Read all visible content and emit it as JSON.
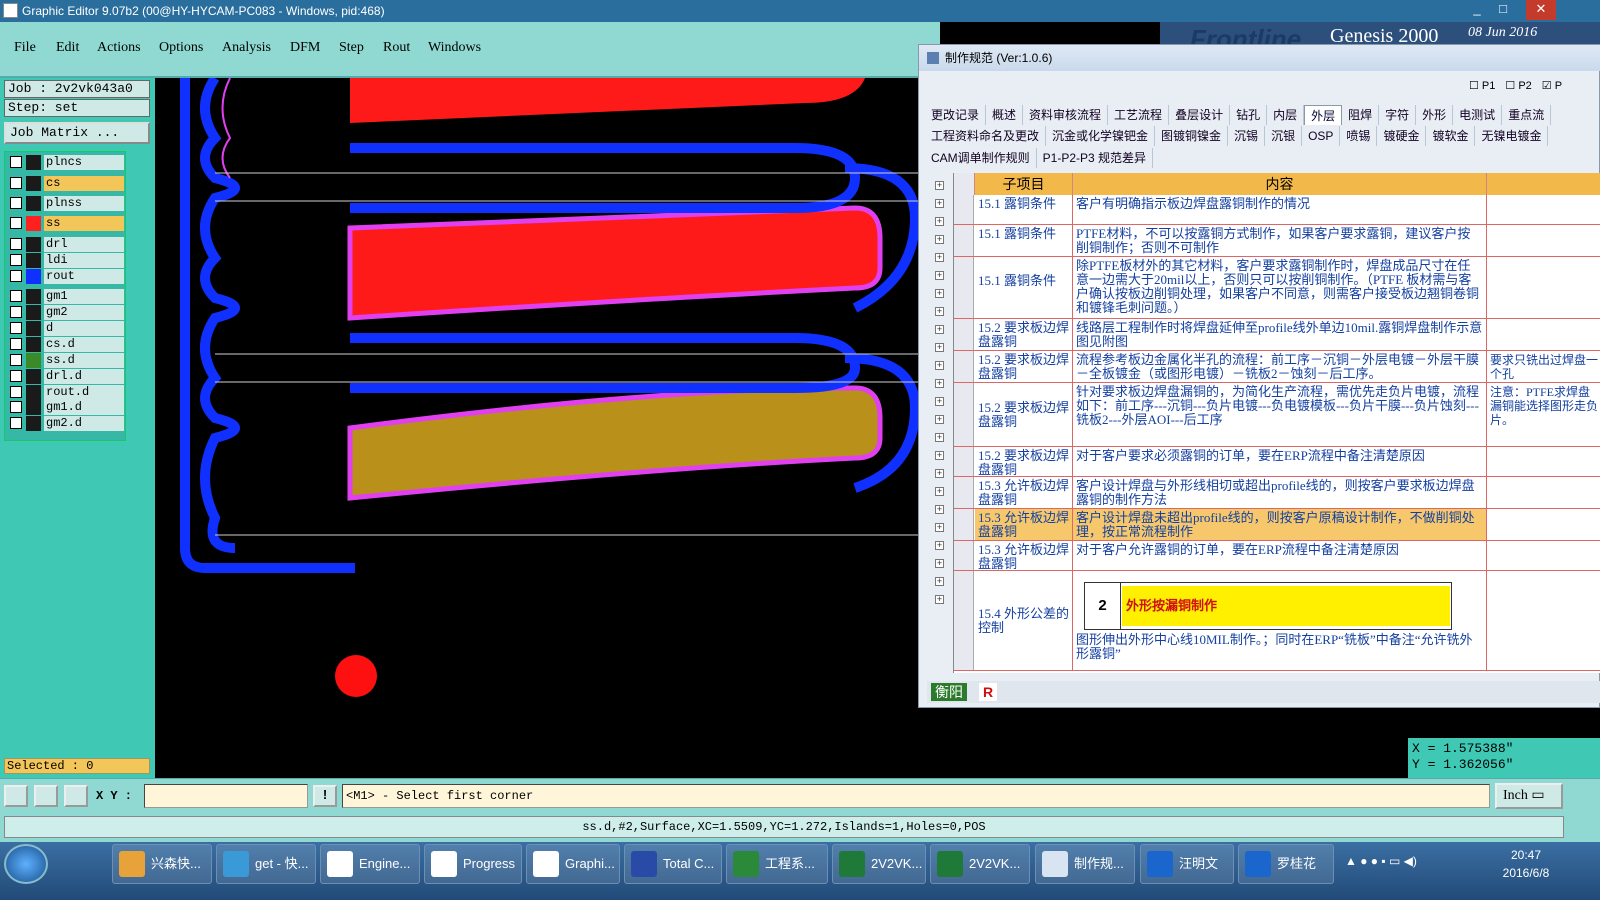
{
  "window": {
    "title": "Graphic Editor 9.07b2 (00@HY-HYCAM-PC083 - Windows, pid:468)",
    "controls": [
      "_",
      "□",
      "✕"
    ]
  },
  "menu": [
    "File",
    "Edit",
    "Actions",
    "Options",
    "Analysis",
    "DFM",
    "Step",
    "Rout",
    "Windows"
  ],
  "left": {
    "job": "Job : 2v2vk043a0",
    "step": "Step: set",
    "job_matrix": "Job Matrix ...",
    "layers": [
      {
        "name": "plncs",
        "color": "#1a1a1a",
        "bg": "#cfeae6"
      },
      {
        "name": "cs",
        "color": "#1a1a1a",
        "bg": "#f3c65a"
      },
      {
        "name": "plnss",
        "color": "#1a1a1a",
        "bg": "#cfeae6"
      },
      {
        "name": "ss",
        "color": "#ff2020",
        "bg": "#f3c65a"
      },
      {
        "name": "drl",
        "color": "#1a1a1a",
        "bg": "#cfeae6"
      },
      {
        "name": "ldi",
        "color": "#1a1a1a",
        "bg": "#cfeae6"
      },
      {
        "name": "rout",
        "color": "#1030ff",
        "bg": "#cfeae6"
      },
      {
        "name": "gm1",
        "color": "#1a1a1a",
        "bg": "#cfeae6"
      },
      {
        "name": "gm2",
        "color": "#1a1a1a",
        "bg": "#cfeae6"
      },
      {
        "name": "d",
        "color": "#1a1a1a",
        "bg": "#cfeae6"
      },
      {
        "name": "cs.d",
        "color": "#1a1a1a",
        "bg": "#cfeae6"
      },
      {
        "name": "ss.d",
        "color": "#3a8a2a",
        "bg": "#cfeae6"
      },
      {
        "name": "drl.d",
        "color": "#1a1a1a",
        "bg": "#cfeae6"
      },
      {
        "name": "rout.d",
        "color": "#1a1a1a",
        "bg": "#cfeae6"
      },
      {
        "name": "gm1.d",
        "color": "#1a1a1a",
        "bg": "#cfeae6"
      },
      {
        "name": "gm2.d",
        "color": "#1a1a1a",
        "bg": "#cfeae6"
      }
    ],
    "selected": "Selected : 0"
  },
  "banner": {
    "brand": "Frontline",
    "product": "Genesis 2000",
    "date": "08 Jun 2016"
  },
  "popup": {
    "title": "制作规范 (Ver:1.0.6)",
    "checks": [
      "P1",
      "P2",
      "P"
    ],
    "tabs_row1": [
      "更改记录",
      "概述",
      "资料审核流程",
      "工艺流程",
      "叠层设计",
      "钻孔",
      "内层",
      "外层",
      "阻焊",
      "字符",
      "外形",
      "电测试",
      "重点流"
    ],
    "active_tab": "外层",
    "tabs_row2": [
      "工程资料命名及更改",
      "沉金或化学镍钯金",
      "图镀铜镍金",
      "沉锡",
      "沉银",
      "OSP",
      "喷锡",
      "镀硬金",
      "镀软金",
      "无镍电镀金"
    ],
    "tabs_row3": [
      "CAM调单制作规则",
      "P1-P2-P3 规范差异"
    ],
    "header": [
      "子项目",
      "内容"
    ],
    "rows": [
      {
        "sub": "15.1 露铜条件",
        "content": "客户有明确指示板边焊盘露铜制作的情况",
        "note": ""
      },
      {
        "sub": "15.1 露铜条件",
        "content": "PTFE材料，不可以按露铜方式制作，如果客户要求露铜，建议客户按削铜制作；否则不可制作",
        "note": ""
      },
      {
        "sub": "15.1 露铜条件",
        "content": "除PTFE板材外的其它材料，客户要求露铜制作时，焊盘成品尺寸在任意一边需大于20mil以上，否则只可以按削铜制作。（PTFE 板材需与客户确认按板边削铜处理，如果客户不同意，则需客户接受板边翘铜卷铜和镀锋毛刺问题。）",
        "note": ""
      },
      {
        "sub": "15.2 要求板边焊盘露铜",
        "content": "线路层工程制作时将焊盘延伸至profile线外单边10mil.露铜焊盘制作示意图见附图",
        "note": ""
      },
      {
        "sub": "15.2 要求板边焊盘露铜",
        "content": "流程参考板边金属化半孔的流程：前工序－沉铜－外层电镀－外层干膜－全板镀金（或图形电镀）－铣板2－蚀刻－后工序。",
        "note": "要求只铣出过焊盘一个孔"
      },
      {
        "sub": "15.2 要求板边焊盘露铜",
        "content": "针对要求板边焊盘漏铜的，为简化生产流程，需优先走负片电镀，流程如下：前工序---沉铜---负片电镀---负电镀模板---负片干膜---负片蚀刻---铣板2---外层AOI---后工序",
        "note": "注意：PTFE求焊盘漏铜能选择图形走负片。"
      },
      {
        "sub": "15.2 要求板边焊盘露铜",
        "content": "对于客户要求必须露铜的订单，要在ERP流程中备注清楚原因",
        "note": ""
      },
      {
        "sub": "15.3 允许板边焊盘露铜",
        "content": "客户设计焊盘与外形线相切或超出profile线的，则按客户要求板边焊盘露铜的制作方法",
        "note": ""
      },
      {
        "sub": "15.3 允许板边焊盘露铜",
        "content": "客户设计焊盘未超出profile线的，则按客户原稿设计制作，不做削铜处理，按正常流程制作",
        "note": ""
      },
      {
        "sub": "15.3 允许板边焊盘露铜",
        "content": "对于客户允许露铜的订单，要在ERP流程中备注清楚原因",
        "note": ""
      },
      {
        "sub": "15.4 外形公差的控制",
        "content": "图形伸出外形中心线10MIL制作。；同时在ERP“铣板”中备注“允许铣外形露铜”",
        "note": ""
      }
    ],
    "embedded_num": "2",
    "embedded_text": "外形按漏铜制作",
    "status_left": "衡阳",
    "status_r": "R"
  },
  "coords": {
    "x": "X = 1.575388\"",
    "y": "Y = 1.362056\""
  },
  "cmd": {
    "xy_label": "X Y :",
    "xy_value": "",
    "prompt": "<M1> - Select first corner",
    "unit": "Inch"
  },
  "info": "ss.d,#2,Surface,XC=1.5509,YC=1.272,Islands=1,Holes=0,POS",
  "taskbar": {
    "items": [
      {
        "label": "兴森快...",
        "color": "#e8a23a"
      },
      {
        "label": "get - 快...",
        "color": "#3a9ad8"
      },
      {
        "label": "Engine...",
        "color": "#ffffff"
      },
      {
        "label": "Progress",
        "color": "#ffffff"
      },
      {
        "label": "Graphi...",
        "color": "#ffffff"
      },
      {
        "label": "Total C...",
        "color": "#2a4aa8"
      },
      {
        "label": "工程系...",
        "color": "#2a8a3a"
      },
      {
        "label": "2V2VK...",
        "color": "#1f7a3a"
      },
      {
        "label": "2V2VK...",
        "color": "#1f7a3a"
      },
      {
        "label": "制作规...",
        "color": "#d9e4f3"
      },
      {
        "label": "汪明文",
        "color": "#1a66cc"
      },
      {
        "label": "罗桂花",
        "color": "#1a66cc"
      }
    ],
    "time": "20:47",
    "date": "2016/6/8"
  }
}
